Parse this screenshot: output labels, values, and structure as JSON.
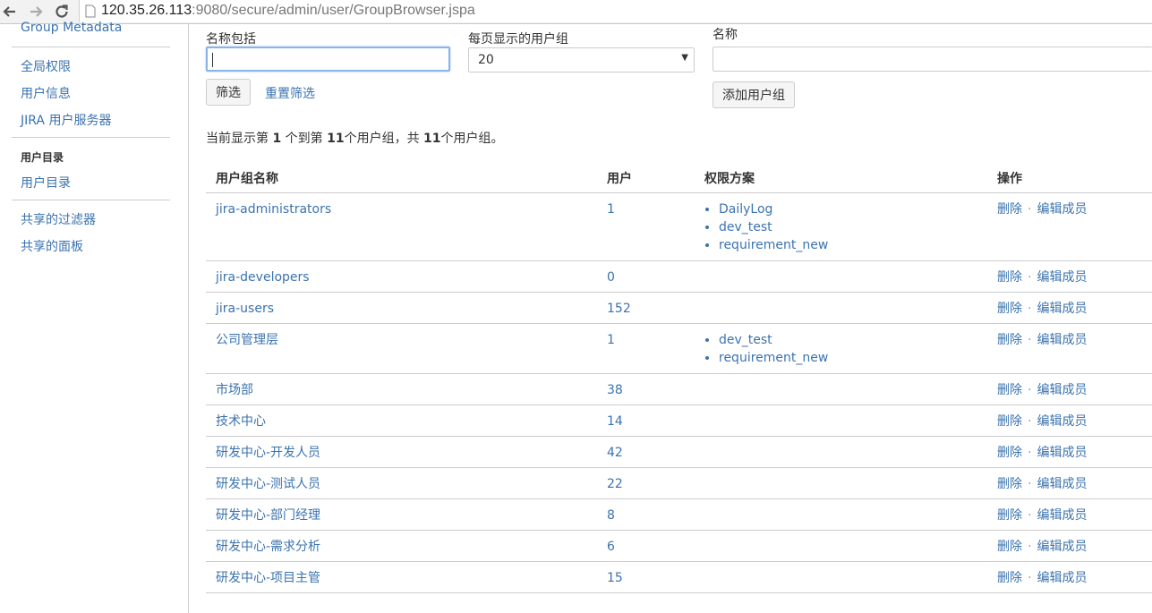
{
  "browser": {
    "url_host": "120.35.26.113",
    "url_rest": ":9080/secure/admin/user/GroupBrowser.jspa"
  },
  "sidebar": {
    "cut_item": "Group Metadata",
    "items_top": [
      "全局权限",
      "用户信息",
      "JIRA 用户服务器"
    ],
    "section_heading": "用户目录",
    "items_mid": [
      "用户目录"
    ],
    "items_bottom": [
      "共享的过滤器",
      "共享的面板"
    ]
  },
  "filter": {
    "name_label": "名称包括",
    "name_value": "",
    "per_page_label": "每页显示的用户组",
    "per_page_value": "20",
    "filter_button": "筛选",
    "reset_link": "重置筛选",
    "add_name_label": "名称",
    "add_name_value": "",
    "add_button": "添加用户组"
  },
  "summary": {
    "prefix": "当前显示第 ",
    "from": "1",
    "mid1": " 个到第 ",
    "to": "11",
    "mid2": "个用户组，共 ",
    "total": "11",
    "suffix": "个用户组。"
  },
  "table": {
    "headers": [
      "用户组名称",
      "用户",
      "权限方案",
      "操作"
    ],
    "delete_label": "删除",
    "edit_label": "编辑成员",
    "rows": [
      {
        "name": "jira-administrators",
        "users": "1",
        "schemes": [
          "DailyLog",
          "dev_test",
          "requirement_new"
        ]
      },
      {
        "name": "jira-developers",
        "users": "0",
        "schemes": []
      },
      {
        "name": "jira-users",
        "users": "152",
        "schemes": []
      },
      {
        "name": "公司管理层",
        "users": "1",
        "schemes": [
          "dev_test",
          "requirement_new"
        ]
      },
      {
        "name": "市场部",
        "users": "38",
        "schemes": []
      },
      {
        "name": "技术中心",
        "users": "14",
        "schemes": []
      },
      {
        "name": "研发中心-开发人员",
        "users": "42",
        "schemes": []
      },
      {
        "name": "研发中心-测试人员",
        "users": "22",
        "schemes": []
      },
      {
        "name": "研发中心-部门经理",
        "users": "8",
        "schemes": []
      },
      {
        "name": "研发中心-需求分析",
        "users": "6",
        "schemes": []
      },
      {
        "name": "研发中心-项目主管",
        "users": "15",
        "schemes": []
      }
    ]
  }
}
